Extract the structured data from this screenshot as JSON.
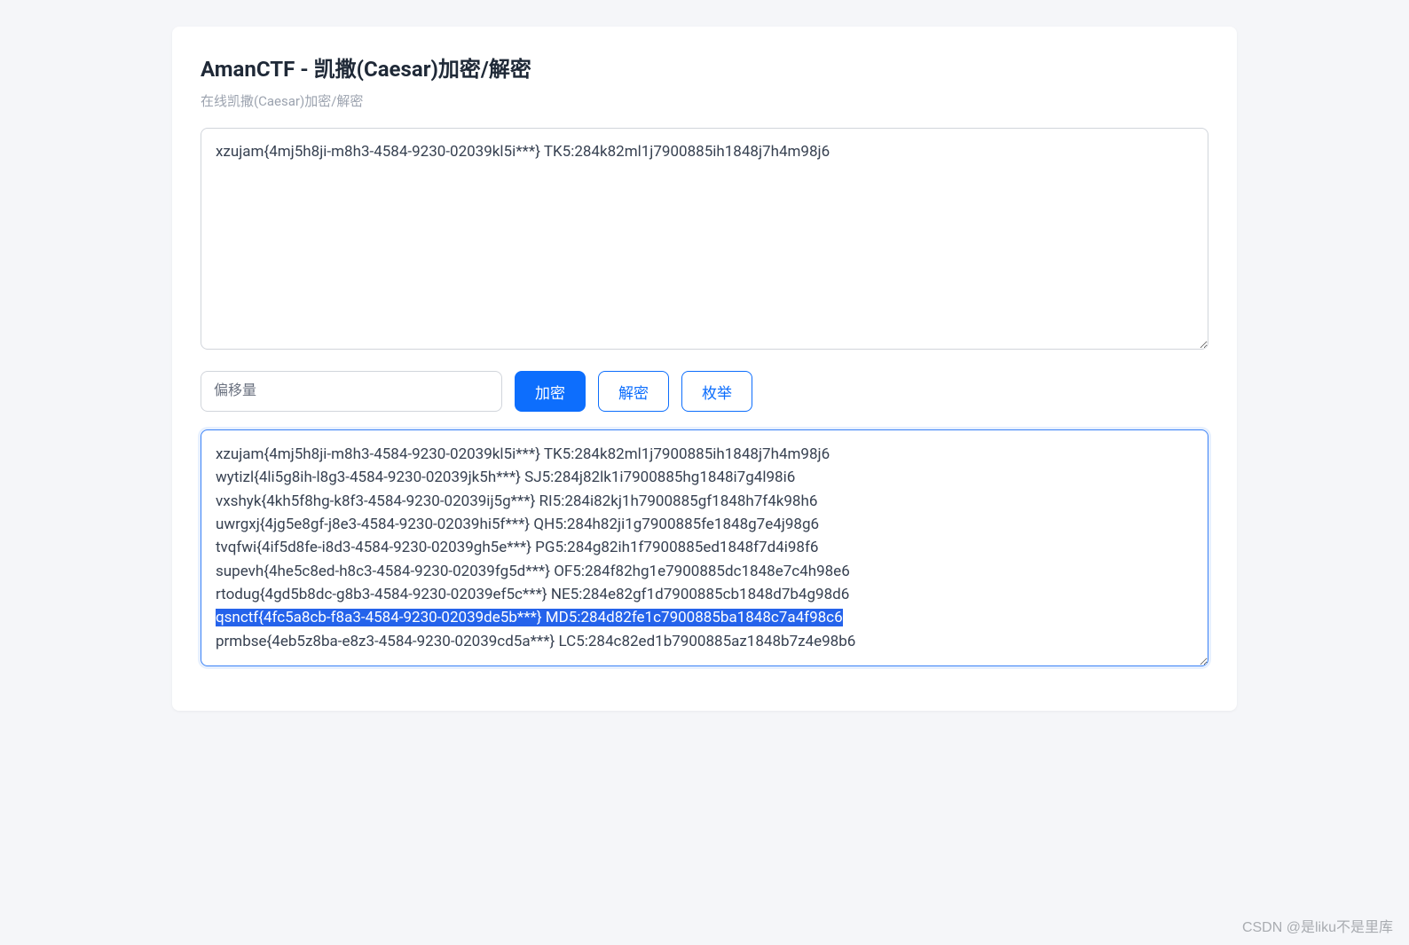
{
  "header": {
    "title": "AmanCTF - 凯撒(Caesar)加密/解密",
    "subtitle": "在线凯撒(Caesar)加密/解密"
  },
  "input": {
    "value": "xzujam{4mj5h8ji-m8h3-4584-9230-02039kl5i***} TK5:284k82ml1j7900885ih1848j7h4m98j6"
  },
  "controls": {
    "offset_placeholder": "偏移量",
    "offset_value": "",
    "encrypt_label": "加密",
    "decrypt_label": "解密",
    "enumerate_label": "枚举"
  },
  "output": {
    "lines": [
      "xzujam{4mj5h8ji-m8h3-4584-9230-02039kl5i***} TK5:284k82ml1j7900885ih1848j7h4m98j6",
      "wytizl{4li5g8ih-l8g3-4584-9230-02039jk5h***} SJ5:284j82lk1i7900885hg1848i7g4l98i6",
      "vxshyk{4kh5f8hg-k8f3-4584-9230-02039ij5g***} RI5:284i82kj1h7900885gf1848h7f4k98h6",
      "uwrgxj{4jg5e8gf-j8e3-4584-9230-02039hi5f***} QH5:284h82ji1g7900885fe1848g7e4j98g6",
      "tvqfwi{4if5d8fe-i8d3-4584-9230-02039gh5e***} PG5:284g82ih1f7900885ed1848f7d4i98f6",
      "supevh{4he5c8ed-h8c3-4584-9230-02039fg5d***} OF5:284f82hg1e7900885dc1848e7c4h98e6",
      "rtodug{4gd5b8dc-g8b3-4584-9230-02039ef5c***} NE5:284e82gf1d7900885cb1848d7b4g98d6",
      "qsnctf{4fc5a8cb-f8a3-4584-9230-02039de5b***} MD5:284d82fe1c7900885ba1848c7a4f98c6",
      "prmbse{4eb5z8ba-e8z3-4584-9230-02039cd5a***} LC5:284c82ed1b7900885az1848b7z4e98b6"
    ],
    "highlighted_index": 7
  },
  "watermark": "CSDN @是liku不是里库"
}
